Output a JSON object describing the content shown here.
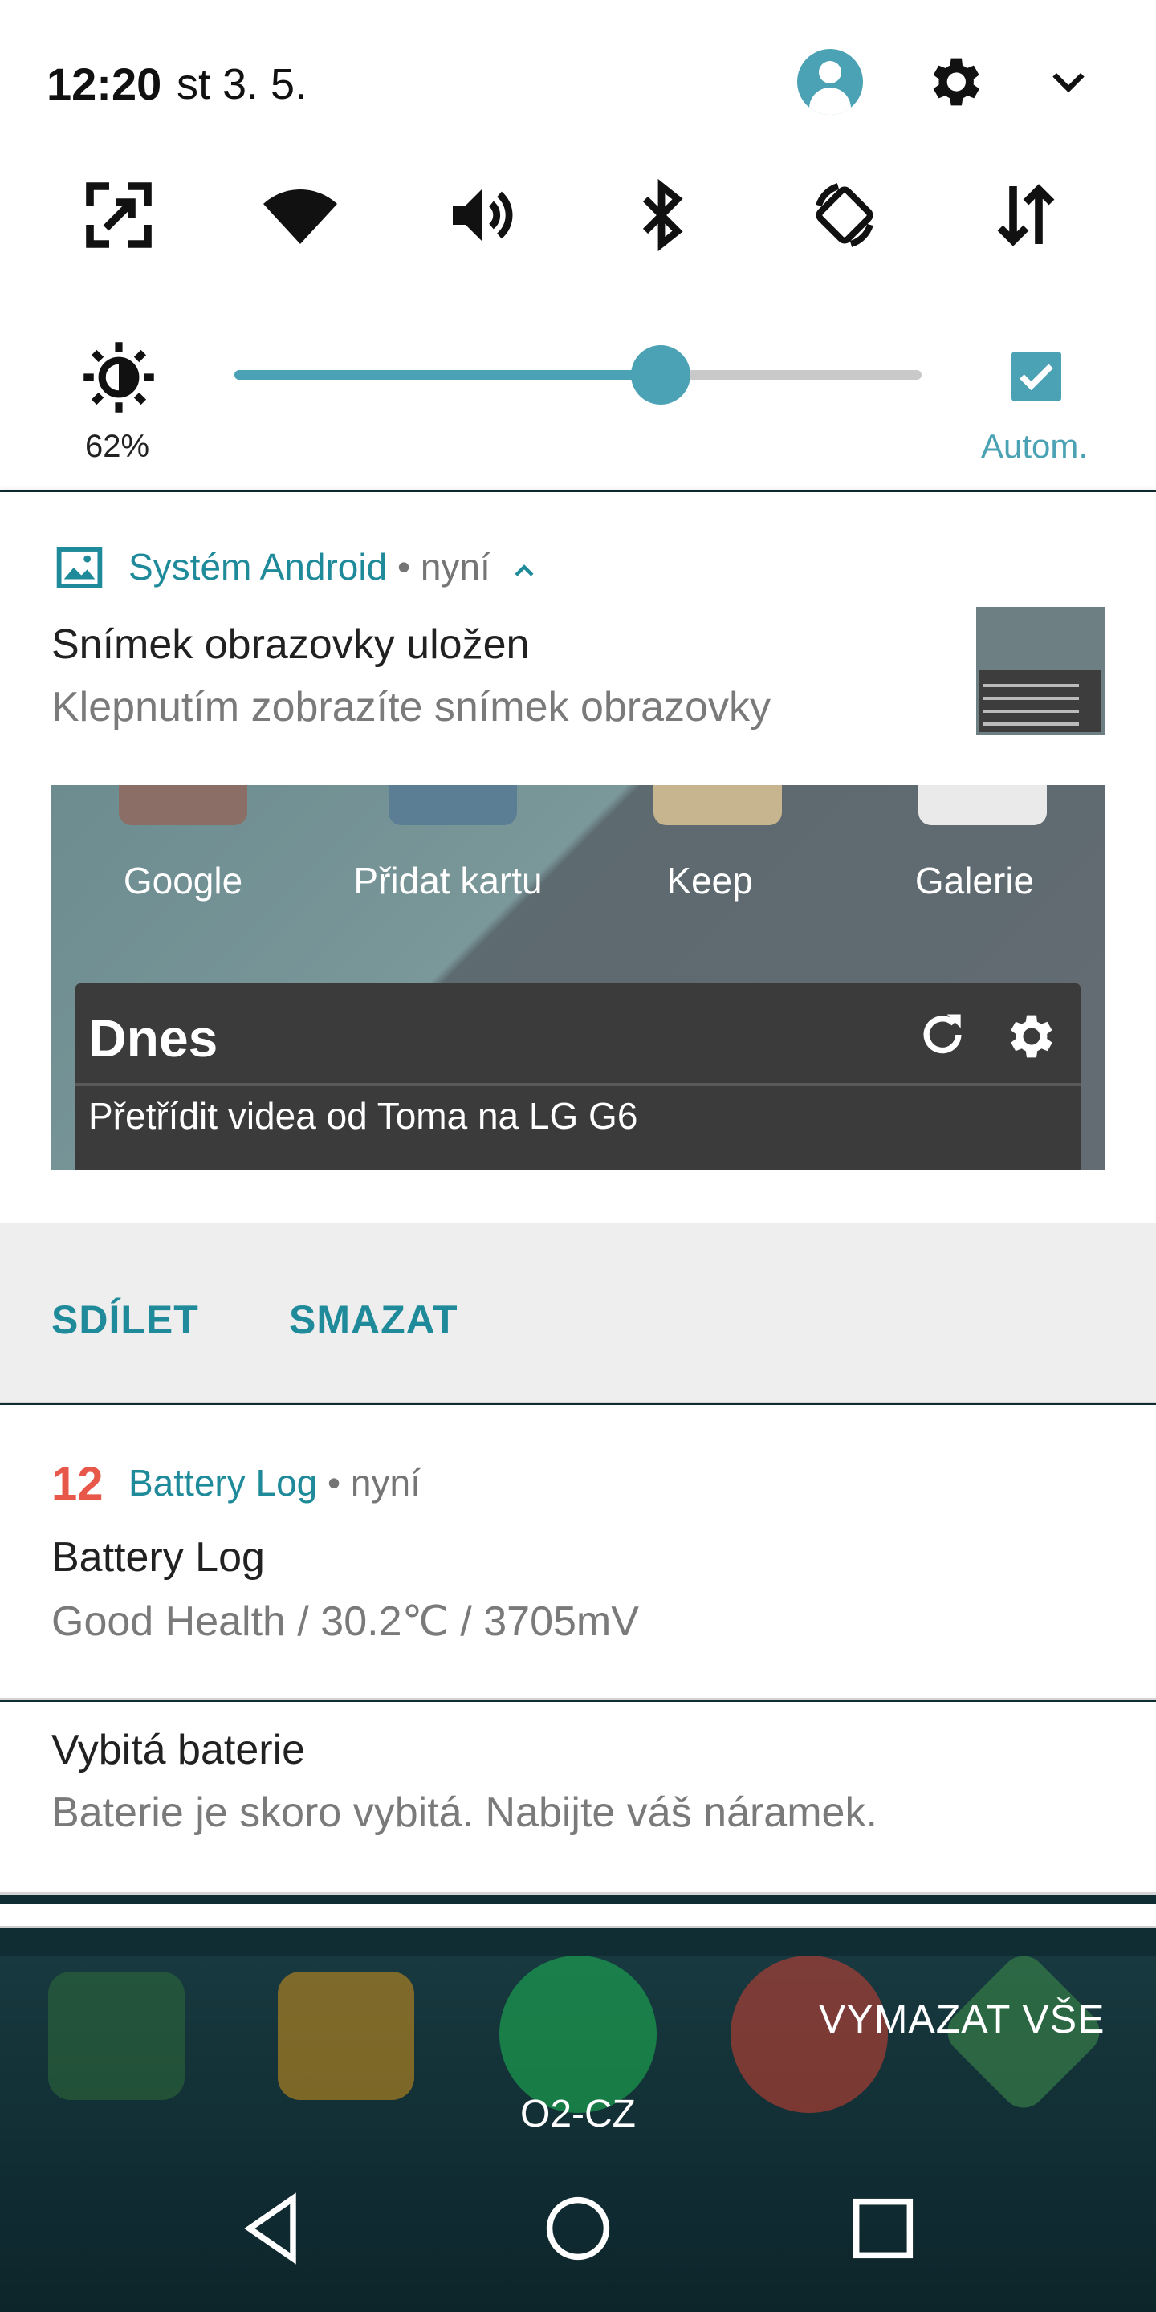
{
  "status": {
    "time": "12:20",
    "date": "st 3. 5."
  },
  "header_icons": [
    "user-avatar-icon",
    "gear-icon",
    "chevron-down-icon"
  ],
  "quick_tiles": [
    "screen-capture-icon",
    "wifi-icon",
    "volume-icon",
    "bluetooth-icon",
    "auto-rotate-icon",
    "data-transfer-icon"
  ],
  "brightness": {
    "percent_label": "62%",
    "level": 0.62,
    "auto_label": "Autom.",
    "auto_checked": true
  },
  "colors": {
    "accent": "#4aa2b4",
    "teal_text": "#1e8a9a",
    "battery_icon": "#e8584a"
  },
  "notifications": [
    {
      "app": "Systém Android",
      "time": "• nyní",
      "title": "Snímek obrazovky uložen",
      "text": "Klepnutím zobrazíte snímek obrazovky",
      "preview": {
        "apps": [
          "Google",
          "Přidat kartu",
          "Keep",
          "Galerie"
        ],
        "widget_title": "Dnes",
        "widget_task": "Přetřídit videa od Toma na LG G6"
      },
      "actions": [
        "SDÍLET",
        "SMAZAT"
      ]
    },
    {
      "app_icon_text": "12",
      "app": "Battery Log",
      "time": "• nyní",
      "title": "Battery Log",
      "text": "Good Health / 30.2℃ / 3705mV"
    },
    {
      "title": "Vybitá baterie",
      "text": "Baterie je skoro vybitá. Nabijte váš náramek."
    }
  ],
  "home": {
    "carrier": "O2-CZ",
    "clear_all": "VYMAZAT VŠE"
  },
  "nav_buttons": [
    "back-icon",
    "home-icon",
    "recents-icon"
  ]
}
